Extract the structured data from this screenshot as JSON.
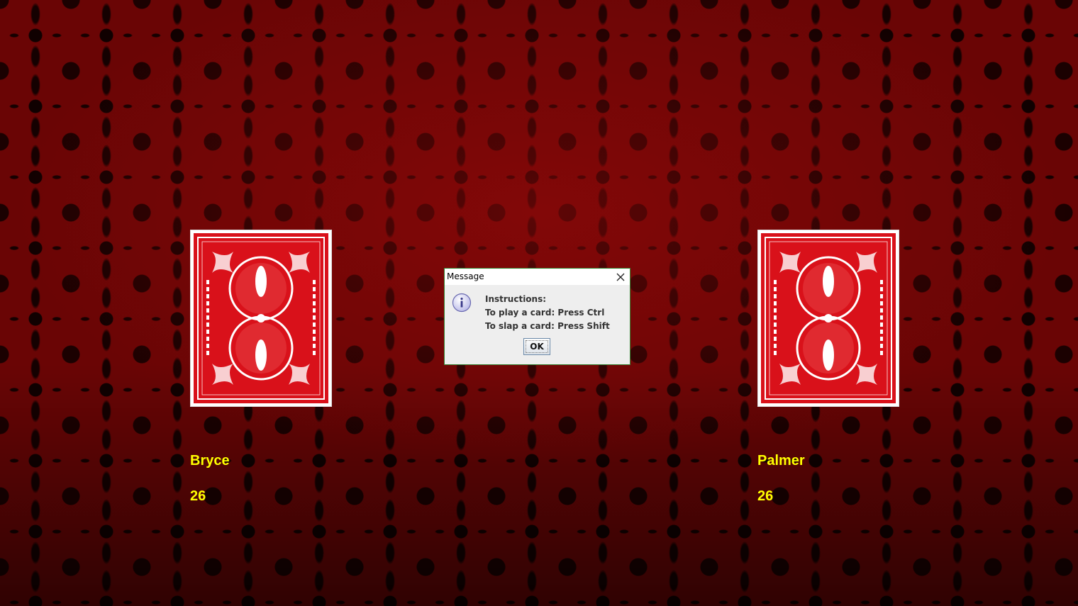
{
  "players": [
    {
      "name": "Bryce",
      "count": "26"
    },
    {
      "name": "Palmer",
      "count": "26"
    }
  ],
  "dialog": {
    "title": "Message",
    "lines": [
      "Instructions:",
      "To play a card: Press Ctrl",
      "To slap a card: Press Shift"
    ],
    "ok_label": "OK",
    "icon": "info-icon"
  },
  "colors": {
    "table": "#6a0505",
    "card_back": "#d9111a",
    "player_text": "#ffff00"
  }
}
